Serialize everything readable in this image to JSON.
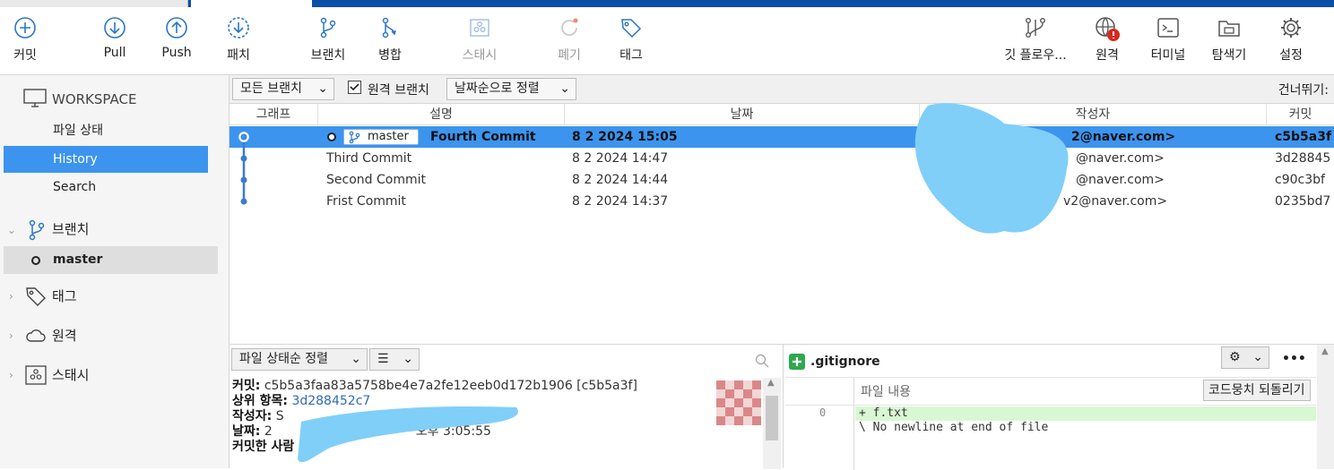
{
  "toolbar": {
    "commit": "커밋",
    "pull": "Pull",
    "push": "Push",
    "patch": "패치",
    "branch": "브랜치",
    "merge": "병합",
    "stash": "스태시",
    "discard": "폐기",
    "tag": "태그",
    "git_flow": "깃 플로우...",
    "remote": "원격",
    "terminal": "터미널",
    "explorer": "탐색기",
    "settings": "설정"
  },
  "sidebar": {
    "workspace": "WORKSPACE",
    "items": [
      {
        "label": "파일 상태"
      },
      {
        "label": "History"
      },
      {
        "label": "Search"
      }
    ],
    "branches_label": "브랜치",
    "current_branch": "master",
    "tags_label": "태그",
    "remotes_label": "원격",
    "stash_label": "스태시"
  },
  "filters": {
    "branch_filter": "모든 브랜치",
    "remote_branches": "원격 브랜치",
    "sort": "날짜순으로 정렬",
    "jump": "건너뛰기:"
  },
  "columns": {
    "graph": "그래프",
    "description": "설명",
    "date": "날짜",
    "author": "작성자",
    "commit": "커밋"
  },
  "commits": [
    {
      "description": "Fourth Commit",
      "branch": "master",
      "date": "8 2 2024 15:05",
      "author": "2@naver.com>",
      "hash": "c5b5a3f"
    },
    {
      "description": "Third Commit",
      "date": "8 2 2024 14:47",
      "author": "@naver.com>",
      "hash": "3d28845"
    },
    {
      "description": "Second Commit",
      "date": "8 2 2024 14:44",
      "author": "@naver.com>",
      "hash": "c90c3bf"
    },
    {
      "description": "Frist Commit",
      "date": "8 2 2024 14:37",
      "author": "v2@naver.com>",
      "hash": "0235bd7"
    }
  ],
  "details": {
    "file_sort": "파일 상태순 정렬",
    "commit_label": "커밋:",
    "commit_value": "c5b5a3faa83a5758be4e7a2fe12eeb0d172b1906 [c5b5a3f]",
    "parent_label": "상위 항목:",
    "parent_value": "3d288452c7",
    "author_label": "작성자:",
    "author_value": "S",
    "date_label": "날짜:",
    "date_value_prefix": "2",
    "date_value": "오후 3:05:55",
    "committer_label": "커밋한 사람"
  },
  "diff": {
    "file_name": ".gitignore",
    "header": "파일 내용",
    "revert_hunk": "코드뭉치 되돌리기",
    "line_no": "0",
    "added_line": "+ f.txt",
    "note_line": "\\ No newline at end of file",
    "more": "•••"
  },
  "colors": {
    "accent": "#3c94ef",
    "topbar": "#0a4fa8",
    "redact": "#80cff9"
  }
}
